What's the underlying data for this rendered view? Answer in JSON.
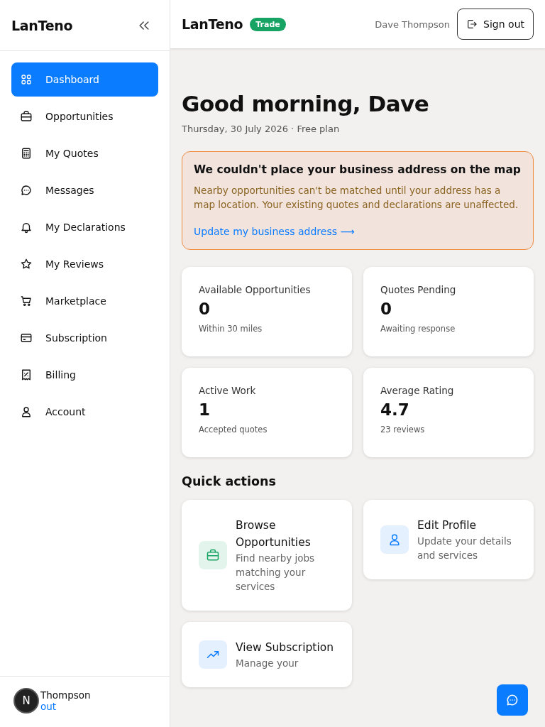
{
  "sidebar": {
    "brand": "LanTeno",
    "items": [
      {
        "label": "Dashboard",
        "selected": true
      },
      {
        "label": "Opportunities",
        "selected": false
      },
      {
        "label": "My Quotes",
        "selected": false
      },
      {
        "label": "Messages",
        "selected": false
      },
      {
        "label": "My Declarations",
        "selected": false
      },
      {
        "label": "My Reviews",
        "selected": false
      },
      {
        "label": "Marketplace",
        "selected": false
      },
      {
        "label": "Subscription",
        "selected": false
      },
      {
        "label": "Billing",
        "selected": false
      },
      {
        "label": "Account",
        "selected": false
      }
    ],
    "footer": {
      "name_visible": "Thompson",
      "link_visible": "out",
      "badge": "N"
    }
  },
  "header": {
    "brand": "LanTeno",
    "badge": "Trade",
    "user": "Dave Thompson",
    "sign_out": "Sign out"
  },
  "greeting": {
    "title": "Good morning, Dave",
    "subtitle": "Thursday, 30 July 2026 · Free plan"
  },
  "alert": {
    "title": "We couldn't place your business address on the map",
    "body": "Nearby opportunities can't be matched until your address has a map location. Your existing quotes and declarations are unaffected.",
    "link": "Update my business address ⟶"
  },
  "stats": [
    {
      "label": "Available Opportunities",
      "value": "0",
      "note": "Within 30 miles"
    },
    {
      "label": "Quotes Pending",
      "value": "0",
      "note": "Awaiting response"
    },
    {
      "label": "Active Work",
      "value": "1",
      "note": "Accepted quotes"
    },
    {
      "label": "Average Rating",
      "value": "4.7",
      "note": "23 reviews"
    }
  ],
  "quick_actions": {
    "title": "Quick actions",
    "items": [
      {
        "title": "Browse Opportunities",
        "description": "Find nearby jobs matching your services"
      },
      {
        "title": "Edit Profile",
        "description": "Update your details and services"
      },
      {
        "title": "View Subscription",
        "description": "Manage your"
      }
    ]
  }
}
